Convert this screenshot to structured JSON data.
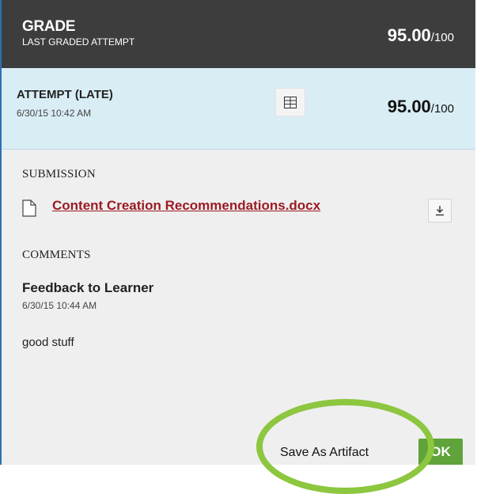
{
  "grade": {
    "title": "GRADE",
    "subtitle": "LAST GRADED ATTEMPT",
    "score": "95.00",
    "max": "/100"
  },
  "attempt": {
    "title": "ATTEMPT (LATE)",
    "date": "6/30/15 10:42 AM",
    "score": "95.00",
    "max": "/100",
    "grid_icon": "grid-icon"
  },
  "submission": {
    "label": "SUBMISSION",
    "file_name": "Content Creation Recommendations.docx",
    "file_icon": "document-icon",
    "download_icon": "download-icon"
  },
  "comments": {
    "label": "COMMENTS",
    "title": "Feedback to Learner",
    "date": "6/30/15 10:44 AM",
    "text": "good stuff"
  },
  "footer": {
    "save_label": "Save As Artifact",
    "ok_label": "OK"
  },
  "colors": {
    "header_bg": "#3d3d3d",
    "attempt_bg": "#d9edf5",
    "link": "#9b1b23",
    "ok_bg": "#5fa33a",
    "highlight": "#8dc63f"
  }
}
